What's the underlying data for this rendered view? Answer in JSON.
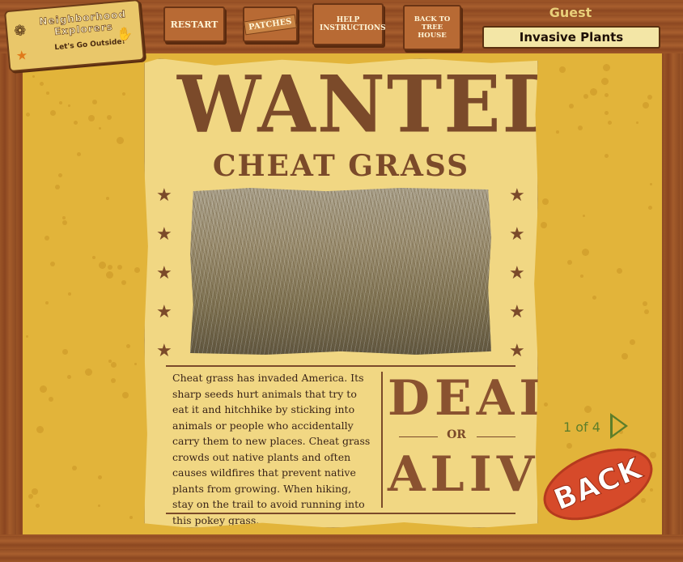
{
  "header": {
    "logo": {
      "name": "Neighborhood Explorers",
      "tagline": "Let's Go Outside!"
    },
    "nav": [
      {
        "label": "RESTART"
      },
      {
        "label": "PATCHES"
      },
      {
        "label": "HELP INSTRUCTIONS"
      },
      {
        "label": "BACK TO TREE HOUSE"
      }
    ],
    "user": "Guest",
    "section_title": "Invasive Plants"
  },
  "poster": {
    "heading": "WANTED",
    "subject": "CHEAT GRASS",
    "description": "Cheat grass has invaded America. Its sharp seeds hurt animals that try to eat it and hitchhike by sticking into animals or people who accidentally carry them to new places.  Cheat grass crowds out native plants and often causes wildfires that prevent native plants from growing. When hiking, stay on the trail to avoid running into this pokey grass.",
    "dead": "DEAD",
    "or": "OR",
    "alive": "ALIVE"
  },
  "pager": {
    "text": "1 of 4"
  },
  "back_label": "BACK",
  "colors": {
    "accent_brown": "#7b4a2a",
    "background_gold": "#e2b43a",
    "back_red": "#d64a2a",
    "pager_green": "#5e7e2a"
  }
}
